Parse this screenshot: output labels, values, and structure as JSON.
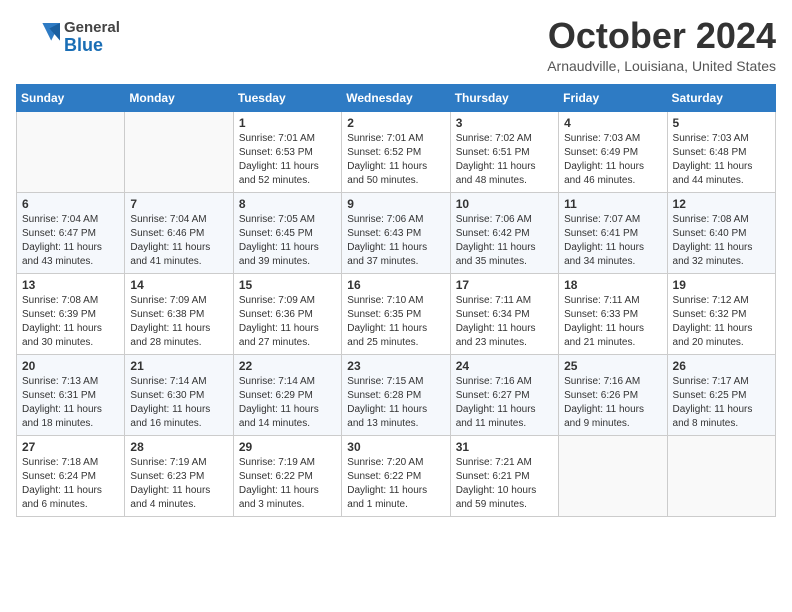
{
  "header": {
    "logo_general": "General",
    "logo_blue": "Blue",
    "month": "October 2024",
    "location": "Arnaudville, Louisiana, United States"
  },
  "days_of_week": [
    "Sunday",
    "Monday",
    "Tuesday",
    "Wednesday",
    "Thursday",
    "Friday",
    "Saturday"
  ],
  "weeks": [
    [
      {
        "day": "",
        "sunrise": "",
        "sunset": "",
        "daylight": ""
      },
      {
        "day": "",
        "sunrise": "",
        "sunset": "",
        "daylight": ""
      },
      {
        "day": "1",
        "sunrise": "Sunrise: 7:01 AM",
        "sunset": "Sunset: 6:53 PM",
        "daylight": "Daylight: 11 hours and 52 minutes."
      },
      {
        "day": "2",
        "sunrise": "Sunrise: 7:01 AM",
        "sunset": "Sunset: 6:52 PM",
        "daylight": "Daylight: 11 hours and 50 minutes."
      },
      {
        "day": "3",
        "sunrise": "Sunrise: 7:02 AM",
        "sunset": "Sunset: 6:51 PM",
        "daylight": "Daylight: 11 hours and 48 minutes."
      },
      {
        "day": "4",
        "sunrise": "Sunrise: 7:03 AM",
        "sunset": "Sunset: 6:49 PM",
        "daylight": "Daylight: 11 hours and 46 minutes."
      },
      {
        "day": "5",
        "sunrise": "Sunrise: 7:03 AM",
        "sunset": "Sunset: 6:48 PM",
        "daylight": "Daylight: 11 hours and 44 minutes."
      }
    ],
    [
      {
        "day": "6",
        "sunrise": "Sunrise: 7:04 AM",
        "sunset": "Sunset: 6:47 PM",
        "daylight": "Daylight: 11 hours and 43 minutes."
      },
      {
        "day": "7",
        "sunrise": "Sunrise: 7:04 AM",
        "sunset": "Sunset: 6:46 PM",
        "daylight": "Daylight: 11 hours and 41 minutes."
      },
      {
        "day": "8",
        "sunrise": "Sunrise: 7:05 AM",
        "sunset": "Sunset: 6:45 PM",
        "daylight": "Daylight: 11 hours and 39 minutes."
      },
      {
        "day": "9",
        "sunrise": "Sunrise: 7:06 AM",
        "sunset": "Sunset: 6:43 PM",
        "daylight": "Daylight: 11 hours and 37 minutes."
      },
      {
        "day": "10",
        "sunrise": "Sunrise: 7:06 AM",
        "sunset": "Sunset: 6:42 PM",
        "daylight": "Daylight: 11 hours and 35 minutes."
      },
      {
        "day": "11",
        "sunrise": "Sunrise: 7:07 AM",
        "sunset": "Sunset: 6:41 PM",
        "daylight": "Daylight: 11 hours and 34 minutes."
      },
      {
        "day": "12",
        "sunrise": "Sunrise: 7:08 AM",
        "sunset": "Sunset: 6:40 PM",
        "daylight": "Daylight: 11 hours and 32 minutes."
      }
    ],
    [
      {
        "day": "13",
        "sunrise": "Sunrise: 7:08 AM",
        "sunset": "Sunset: 6:39 PM",
        "daylight": "Daylight: 11 hours and 30 minutes."
      },
      {
        "day": "14",
        "sunrise": "Sunrise: 7:09 AM",
        "sunset": "Sunset: 6:38 PM",
        "daylight": "Daylight: 11 hours and 28 minutes."
      },
      {
        "day": "15",
        "sunrise": "Sunrise: 7:09 AM",
        "sunset": "Sunset: 6:36 PM",
        "daylight": "Daylight: 11 hours and 27 minutes."
      },
      {
        "day": "16",
        "sunrise": "Sunrise: 7:10 AM",
        "sunset": "Sunset: 6:35 PM",
        "daylight": "Daylight: 11 hours and 25 minutes."
      },
      {
        "day": "17",
        "sunrise": "Sunrise: 7:11 AM",
        "sunset": "Sunset: 6:34 PM",
        "daylight": "Daylight: 11 hours and 23 minutes."
      },
      {
        "day": "18",
        "sunrise": "Sunrise: 7:11 AM",
        "sunset": "Sunset: 6:33 PM",
        "daylight": "Daylight: 11 hours and 21 minutes."
      },
      {
        "day": "19",
        "sunrise": "Sunrise: 7:12 AM",
        "sunset": "Sunset: 6:32 PM",
        "daylight": "Daylight: 11 hours and 20 minutes."
      }
    ],
    [
      {
        "day": "20",
        "sunrise": "Sunrise: 7:13 AM",
        "sunset": "Sunset: 6:31 PM",
        "daylight": "Daylight: 11 hours and 18 minutes."
      },
      {
        "day": "21",
        "sunrise": "Sunrise: 7:14 AM",
        "sunset": "Sunset: 6:30 PM",
        "daylight": "Daylight: 11 hours and 16 minutes."
      },
      {
        "day": "22",
        "sunrise": "Sunrise: 7:14 AM",
        "sunset": "Sunset: 6:29 PM",
        "daylight": "Daylight: 11 hours and 14 minutes."
      },
      {
        "day": "23",
        "sunrise": "Sunrise: 7:15 AM",
        "sunset": "Sunset: 6:28 PM",
        "daylight": "Daylight: 11 hours and 13 minutes."
      },
      {
        "day": "24",
        "sunrise": "Sunrise: 7:16 AM",
        "sunset": "Sunset: 6:27 PM",
        "daylight": "Daylight: 11 hours and 11 minutes."
      },
      {
        "day": "25",
        "sunrise": "Sunrise: 7:16 AM",
        "sunset": "Sunset: 6:26 PM",
        "daylight": "Daylight: 11 hours and 9 minutes."
      },
      {
        "day": "26",
        "sunrise": "Sunrise: 7:17 AM",
        "sunset": "Sunset: 6:25 PM",
        "daylight": "Daylight: 11 hours and 8 minutes."
      }
    ],
    [
      {
        "day": "27",
        "sunrise": "Sunrise: 7:18 AM",
        "sunset": "Sunset: 6:24 PM",
        "daylight": "Daylight: 11 hours and 6 minutes."
      },
      {
        "day": "28",
        "sunrise": "Sunrise: 7:19 AM",
        "sunset": "Sunset: 6:23 PM",
        "daylight": "Daylight: 11 hours and 4 minutes."
      },
      {
        "day": "29",
        "sunrise": "Sunrise: 7:19 AM",
        "sunset": "Sunset: 6:22 PM",
        "daylight": "Daylight: 11 hours and 3 minutes."
      },
      {
        "day": "30",
        "sunrise": "Sunrise: 7:20 AM",
        "sunset": "Sunset: 6:22 PM",
        "daylight": "Daylight: 11 hours and 1 minute."
      },
      {
        "day": "31",
        "sunrise": "Sunrise: 7:21 AM",
        "sunset": "Sunset: 6:21 PM",
        "daylight": "Daylight: 10 hours and 59 minutes."
      },
      {
        "day": "",
        "sunrise": "",
        "sunset": "",
        "daylight": ""
      },
      {
        "day": "",
        "sunrise": "",
        "sunset": "",
        "daylight": ""
      }
    ]
  ]
}
